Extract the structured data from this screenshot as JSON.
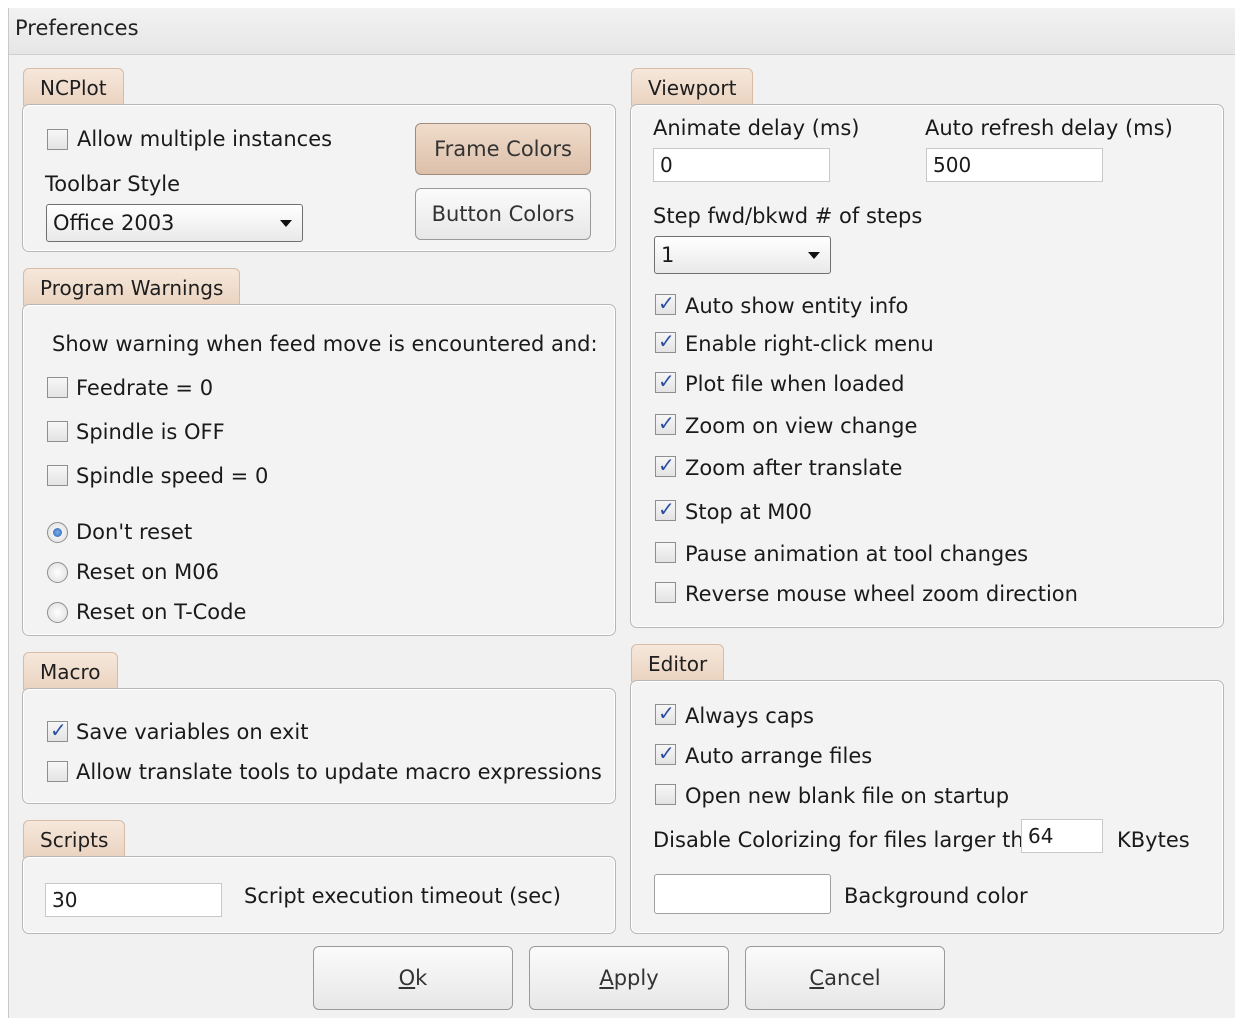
{
  "window": {
    "title": "Preferences"
  },
  "ncplot": {
    "tab": "NCPlot",
    "allow_multiple": {
      "label": "Allow multiple instances",
      "checked": false
    },
    "toolbar_style_label": "Toolbar Style",
    "toolbar_style_value": "Office 2003",
    "frame_colors": "Frame Colors",
    "button_colors": "Button Colors"
  },
  "warnings": {
    "tab": "Program Warnings",
    "intro": "Show warning when feed move is encountered and:",
    "feedrate": {
      "label": "Feedrate = 0",
      "checked": false
    },
    "spindle_off": {
      "label": "Spindle is OFF",
      "checked": false
    },
    "spindle_speed": {
      "label": "Spindle speed = 0",
      "checked": false
    },
    "dont_reset": {
      "label": "Don't reset",
      "selected": true
    },
    "reset_m06": {
      "label": "Reset on M06",
      "selected": false
    },
    "reset_tcode": {
      "label": "Reset on T-Code",
      "selected": false
    }
  },
  "macro": {
    "tab": "Macro",
    "save_vars": {
      "label": "Save variables on exit",
      "checked": true
    },
    "allow_translate": {
      "label": "Allow translate tools to update macro expressions",
      "checked": false
    }
  },
  "scripts": {
    "tab": "Scripts",
    "timeout_value": "30",
    "timeout_label": "Script execution timeout (sec)"
  },
  "viewport": {
    "tab": "Viewport",
    "animate_label": "Animate delay (ms)",
    "animate_value": "0",
    "refresh_label": "Auto refresh delay (ms)",
    "refresh_value": "500",
    "steps_label": "Step fwd/bkwd # of steps",
    "steps_value": "1",
    "auto_show": {
      "label": "Auto show entity info",
      "checked": true
    },
    "right_click": {
      "label": "Enable right-click menu",
      "checked": true
    },
    "plot_loaded": {
      "label": "Plot file when loaded",
      "checked": true
    },
    "zoom_view": {
      "label": "Zoom on view change",
      "checked": true
    },
    "zoom_translate": {
      "label": "Zoom after translate",
      "checked": true
    },
    "stop_m00": {
      "label": "Stop at M00",
      "checked": true
    },
    "pause_anim": {
      "label": "Pause animation at tool changes",
      "checked": false
    },
    "reverse_wheel": {
      "label": "Reverse mouse wheel zoom direction",
      "checked": false
    }
  },
  "editor": {
    "tab": "Editor",
    "always_caps": {
      "label": "Always caps",
      "checked": true
    },
    "auto_arrange": {
      "label": "Auto arrange files",
      "checked": true
    },
    "open_blank": {
      "label": "Open new blank file on startup",
      "checked": false
    },
    "colorize_label": "Disable Colorizing for files larger than",
    "colorize_value": "64",
    "colorize_unit": "KBytes",
    "bg_color_label": "Background color",
    "bg_color_value": "#ffffff"
  },
  "buttons": {
    "ok_hot": "O",
    "ok_rest": "k",
    "apply_hot": "A",
    "apply_rest": "pply",
    "cancel_hot": "C",
    "cancel_rest": "ancel"
  }
}
